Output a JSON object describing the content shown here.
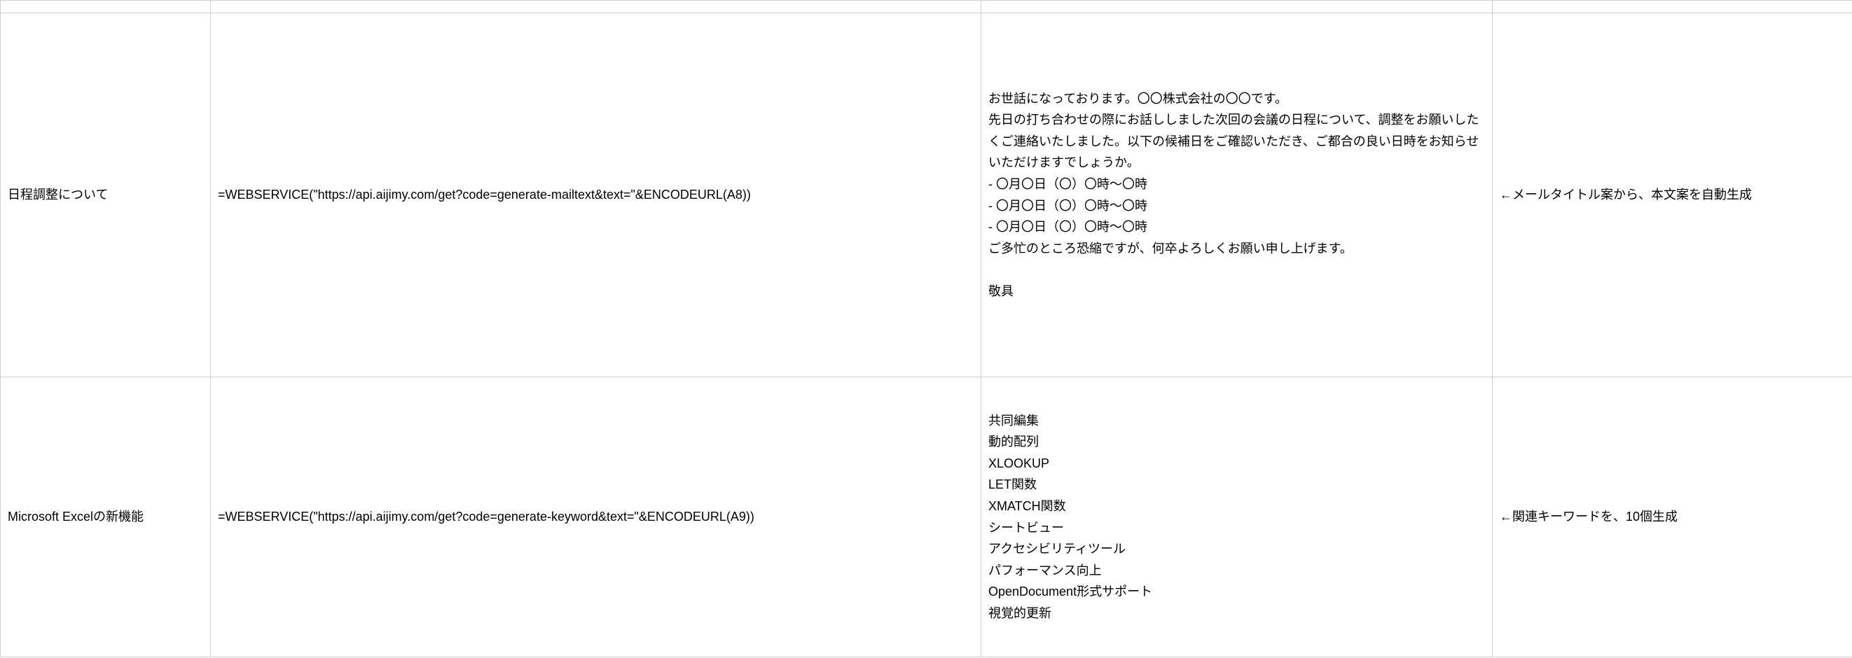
{
  "rows": [
    {
      "colA": "日程調整について",
      "colB": "=WEBSERVICE(\"https://api.aijimy.com/get?code=generate-mailtext&text=\"&ENCODEURL(A8))",
      "colC": "お世話になっております。〇〇株式会社の〇〇です。\n先日の打ち合わせの際にお話ししました次回の会議の日程について、調整をお願いしたくご連絡いたしました。以下の候補日をご確認いただき、ご都合の良い日時をお知らせいただけますでしょうか。\n- 〇月〇日（〇）〇時〜〇時\n- 〇月〇日（〇）〇時〜〇時\n- 〇月〇日（〇）〇時〜〇時\nご多忙のところ恐縮ですが、何卒よろしくお願い申し上げます。\n\n敬具",
      "colD": "←メールタイトル案から、本文案を自動生成"
    },
    {
      "colA": "Microsoft Excelの新機能",
      "colB": "=WEBSERVICE(\"https://api.aijimy.com/get?code=generate-keyword&text=\"&ENCODEURL(A9))",
      "colC": "共同編集\n動的配列\nXLOOKUP\nLET関数\nXMATCH関数\nシートビュー\nアクセシビリティツール\nパフォーマンス向上\nOpenDocument形式サポート\n視覚的更新",
      "colD": "←関連キーワードを、10個生成"
    }
  ]
}
